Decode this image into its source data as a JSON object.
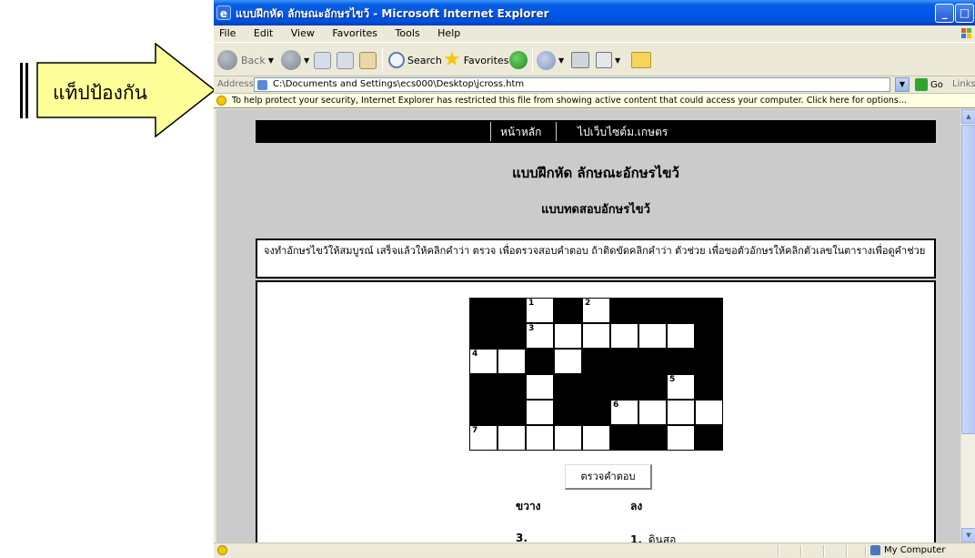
{
  "callout": {
    "label": "แท็ปป้องกัน"
  },
  "window": {
    "title": "แบบฝึกหัด ลักษณะอักษรไขว้ - Microsoft Internet Explorer",
    "controls": {
      "minimize": "_",
      "maximize": "□",
      "close": "×"
    }
  },
  "menu": [
    "File",
    "Edit",
    "View",
    "Favorites",
    "Tools",
    "Help"
  ],
  "toolbar": {
    "back": "Back",
    "search": "Search",
    "favorites": "Favorites"
  },
  "address": {
    "label": "Address",
    "value": "C:\\Documents and Settings\\ecs000\\Desktop\\jcross.htm",
    "go": "Go",
    "links": "Links"
  },
  "infobar": {
    "message": "To help protect your security, Internet Explorer has restricted this file from showing active content that could access your computer. Click here for options..."
  },
  "page": {
    "nav": {
      "home": "หน้าหลัก",
      "site": "ไปเว็บไซต์ม.เกษตร"
    },
    "title": "แบบฝึกหัด ลักษณะอักษรไขว้",
    "subtitle": "แบบทดสอบอักษรไขว้",
    "instructions": "จงทำอักษรไขว้ให้สมบูรณ์ เสร็จแล้วให้คลิกคำว่า ตรวจ เพื่อตรวจสอบคำตอบ ถ้าติดขัดคลิกคำว่า ตัวช่วย เพื่อขอตัวอักษรให้คลิกตัวเลขในตารางเพื่อดูคำช่วย",
    "check_button": "ตรวจคำตอบ",
    "clues": {
      "across_heading": "ขวาง",
      "down_heading": "ลง",
      "across_first": "3.",
      "down_first_num": "1.",
      "down_first_text": "ดินสอ"
    }
  },
  "crossword": {
    "rows": 6,
    "cols": 9,
    "grid": [
      "##W#W####",
      "##WWWWWW#",
      "WW#W#####",
      "##W####W#",
      "##W##WWWW",
      "WWWWW##W#"
    ],
    "numbers": [
      {
        "row": 0,
        "col": 2,
        "n": "1"
      },
      {
        "row": 0,
        "col": 4,
        "n": "2"
      },
      {
        "row": 1,
        "col": 2,
        "n": "3"
      },
      {
        "row": 2,
        "col": 0,
        "n": "4"
      },
      {
        "row": 3,
        "col": 7,
        "n": "5"
      },
      {
        "row": 4,
        "col": 5,
        "n": "6"
      },
      {
        "row": 5,
        "col": 0,
        "n": "7"
      }
    ]
  },
  "status": {
    "zone": "My Computer"
  }
}
